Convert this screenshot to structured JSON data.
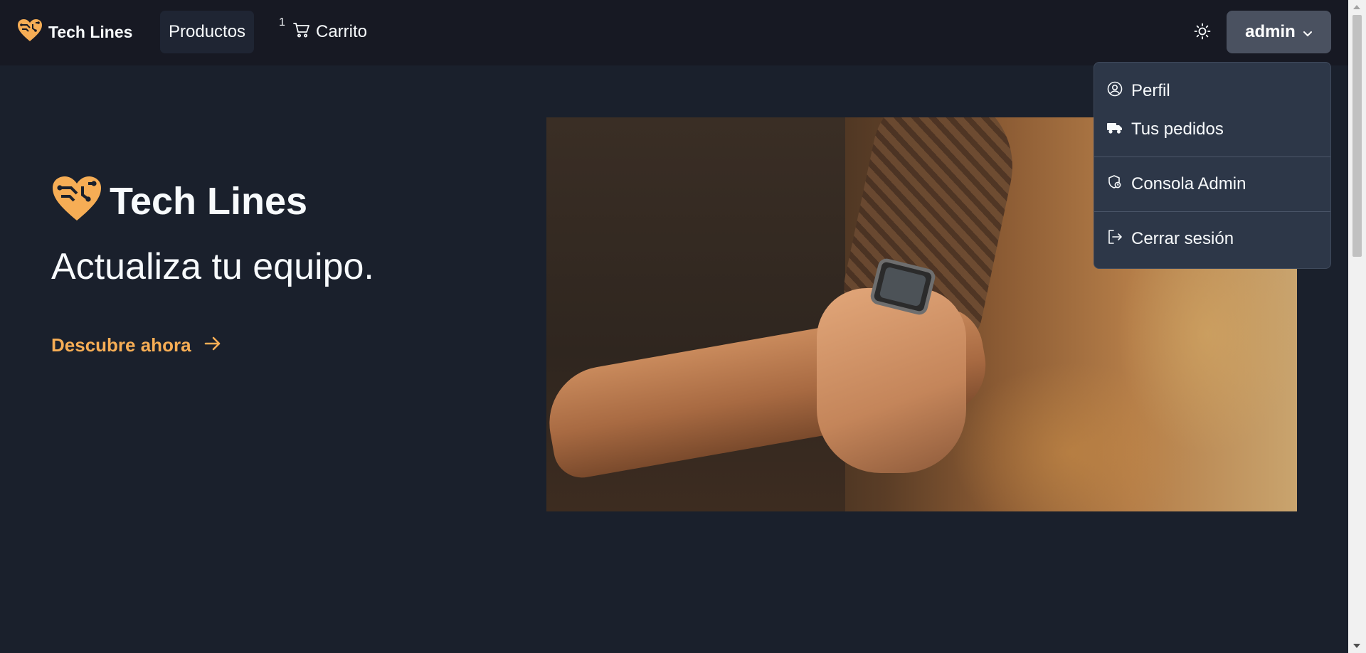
{
  "brand": {
    "name": "Tech Lines",
    "logo_icon": "heart-circuit-icon",
    "accent_color": "#f6ad55"
  },
  "nav": {
    "products_label": "Productos",
    "cart_label": "Carrito",
    "cart_count": "1",
    "theme_icon": "sun-icon"
  },
  "user_menu": {
    "username": "admin",
    "items": [
      {
        "label": "Perfil",
        "icon": "user-circle-icon"
      },
      {
        "label": "Tus pedidos",
        "icon": "truck-icon"
      },
      {
        "label": "Consola Admin",
        "icon": "shield-icon"
      },
      {
        "label": "Cerrar sesión",
        "icon": "logout-icon"
      }
    ]
  },
  "hero": {
    "title": "Tech Lines",
    "tagline": "Actualiza tu equipo.",
    "cta_label": "Descubre ahora"
  },
  "colors": {
    "background": "#1a202c",
    "navbar": "#171923",
    "menu": "#2d3748"
  }
}
